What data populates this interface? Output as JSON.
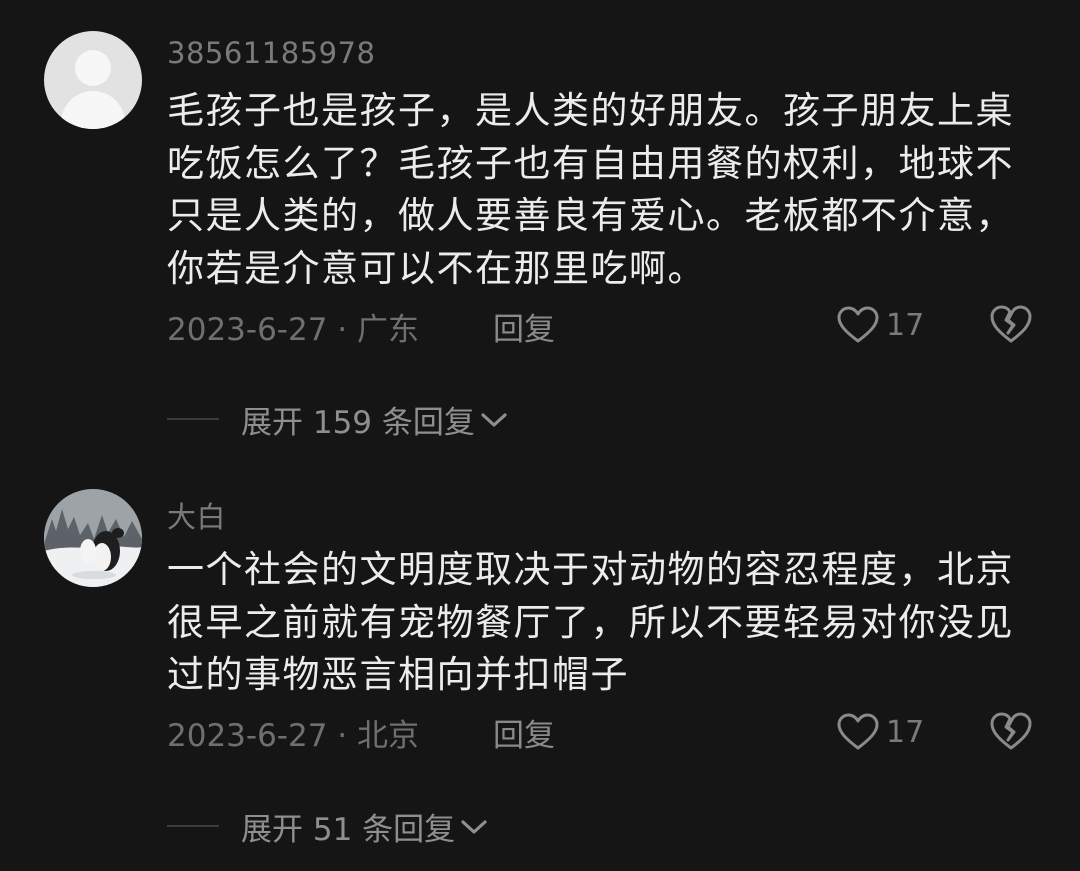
{
  "comments": [
    {
      "username": "38561185978",
      "text": "毛孩子也是孩子，是人类的好朋友。孩子朋友上桌吃饭怎么了？毛孩子也有自由用餐的权利，地球不只是人类的，做人要善良有爱心。老板都不介意，你若是介意可以不在那里吃啊。",
      "meta": "2023-6-27 · 广东",
      "reply_label": "回复",
      "likes": "17",
      "expand_label": "展开 159 条回复",
      "avatar": "default-user-icon"
    },
    {
      "username": "大白",
      "text": "一个社会的文明度取决于对动物的容忍程度，北京很早之前就有宠物餐厅了，所以不要轻易对你没见过的事物恶言相向并扣帽子",
      "meta": "2023-6-27 · 北京",
      "reply_label": "回复",
      "likes": "17",
      "expand_label": "展开 51 条回复",
      "avatar": "photo-snow-dog"
    }
  ],
  "icons": {
    "like": "heart-outline-icon",
    "dislike": "broken-heart-icon",
    "expand": "chevron-down-icon"
  },
  "colors": {
    "background": "#151515",
    "text": "#ececec",
    "muted": "#7a7a7a"
  }
}
